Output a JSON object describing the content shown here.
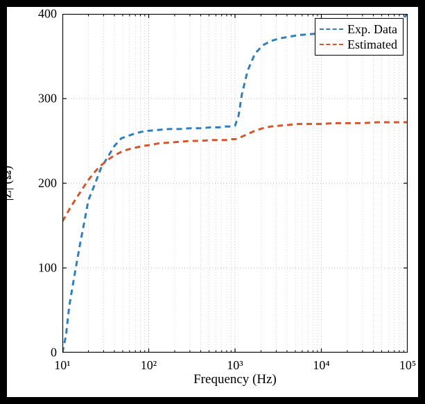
{
  "chart_data": {
    "type": "line",
    "xscale": "log",
    "xlabel": "Frequency (Hz)",
    "ylabel": "|Z| (Ω)",
    "xlim": [
      10,
      100000
    ],
    "ylim": [
      0,
      400
    ],
    "yticks": [
      0,
      100,
      200,
      300,
      400
    ],
    "xticks": [
      10,
      100,
      1000,
      10000,
      100000
    ],
    "xtick_labels": [
      "10¹",
      "10²",
      "10³",
      "10⁴",
      "10⁵"
    ],
    "legend": {
      "position": "top-right",
      "entries": [
        "Exp. Data",
        "Estimated"
      ]
    },
    "colors": {
      "exp": "#2f7fbf",
      "est": "#d4562a",
      "grid": "#bfbfbf"
    },
    "series": [
      {
        "name": "Exp. Data",
        "color": "#2f7fbf",
        "dash": "8,6",
        "x": [
          10,
          11,
          12,
          14,
          16,
          18,
          20,
          24,
          28,
          34,
          40,
          48,
          58,
          70,
          85,
          100,
          130,
          170,
          230,
          300,
          400,
          520,
          650,
          780,
          900,
          1000,
          1100,
          1200,
          1400,
          1700,
          2100,
          2600,
          3300,
          4200,
          5500,
          7300,
          10000,
          14000,
          20000,
          30000,
          45000,
          65000,
          85000,
          100000
        ],
        "y": [
          0,
          20,
          55,
          95,
          128,
          155,
          180,
          200,
          218,
          232,
          244,
          253,
          256,
          259,
          261,
          262,
          263,
          264,
          264,
          265,
          265,
          266,
          266,
          267,
          267,
          268,
          280,
          305,
          333,
          353,
          363,
          368,
          371,
          373,
          375,
          376,
          377,
          378,
          379,
          381,
          384,
          388,
          393,
          400
        ]
      },
      {
        "name": "Estimated",
        "color": "#d4562a",
        "dash": "8,6",
        "x": [
          10,
          11,
          12,
          14,
          16,
          18,
          20,
          24,
          28,
          34,
          40,
          48,
          58,
          70,
          85,
          100,
          130,
          170,
          230,
          300,
          400,
          520,
          650,
          780,
          900,
          1000,
          1100,
          1200,
          1400,
          1700,
          2100,
          2600,
          3300,
          4200,
          5500,
          7300,
          10000,
          14000,
          20000,
          30000,
          45000,
          65000,
          85000,
          100000
        ],
        "y": [
          155,
          162,
          169,
          180,
          189,
          197,
          204,
          214,
          221,
          228,
          233,
          237,
          240,
          242,
          244,
          245,
          247,
          248,
          249,
          250,
          250,
          251,
          251,
          251,
          252,
          252,
          253,
          255,
          258,
          262,
          265,
          267,
          268,
          269,
          270,
          270,
          270,
          271,
          271,
          271,
          272,
          272,
          272,
          272
        ]
      }
    ]
  }
}
